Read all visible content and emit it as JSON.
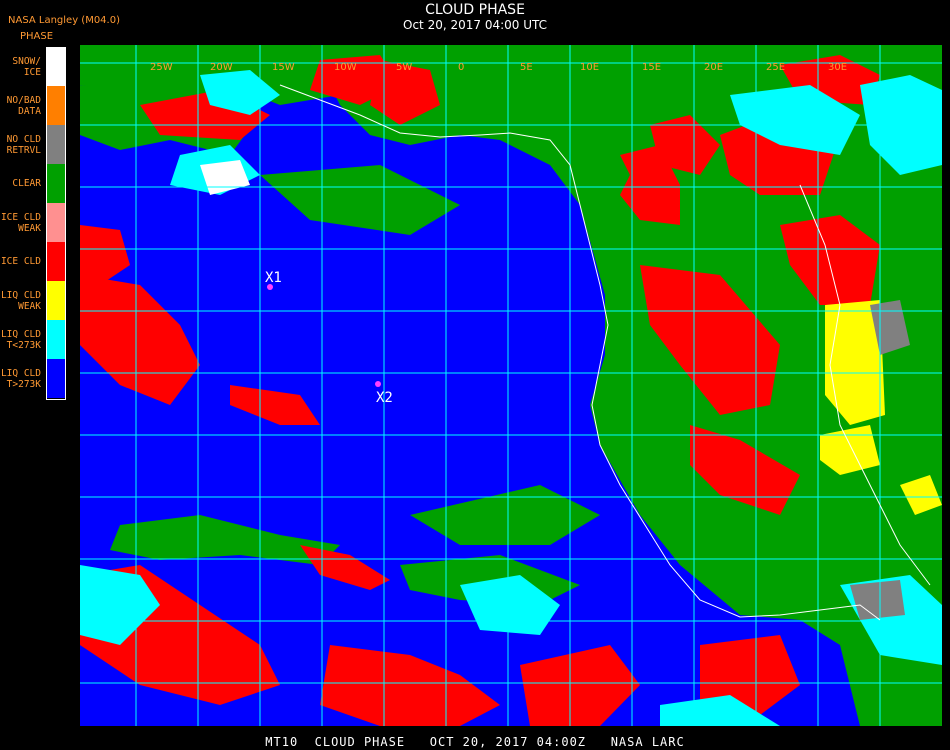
{
  "header": {
    "title": "CLOUD PHASE",
    "timestamp": "Oct 20, 2017 04:00 UTC",
    "org_label": "NASA Langley (M04.0)"
  },
  "legend": {
    "title": "PHASE",
    "items": [
      {
        "lines": [
          "SNOW/",
          "ICE"
        ],
        "color": "#ffffff"
      },
      {
        "lines": [
          "NO/BAD",
          "DATA"
        ],
        "color": "#ff7f00"
      },
      {
        "lines": [
          "NO CLD",
          "RETRVL"
        ],
        "color": "#808080"
      },
      {
        "lines": [
          "CLEAR"
        ],
        "color": "#00a000"
      },
      {
        "lines": [
          "ICE CLD",
          "WEAK"
        ],
        "color": "#ff9090"
      },
      {
        "lines": [
          "ICE CLD"
        ],
        "color": "#ff0000"
      },
      {
        "lines": [
          "LIQ CLD",
          "WEAK"
        ],
        "color": "#ffff00"
      },
      {
        "lines": [
          "LIQ CLD",
          "T<273K"
        ],
        "color": "#00ffff"
      },
      {
        "lines": [
          "LIQ CLD",
          "T>273K"
        ],
        "color": "#0000ff"
      }
    ]
  },
  "map": {
    "longitude_labels": [
      "25W",
      "20W",
      "15W",
      "10W",
      "5W",
      "0",
      "5E",
      "10E",
      "15E",
      "20E",
      "25E",
      "30E"
    ],
    "markers": [
      {
        "label": "X1",
        "color": "#ff40ff"
      },
      {
        "label": "X2",
        "color": "#ff40ff"
      }
    ],
    "colors": {
      "grid": "#00ffff",
      "coast": "#ffffff",
      "longitude_label": "#ff9933"
    }
  },
  "footer": {
    "text": "MT10  CLOUD PHASE   OCT 20, 2017 04:00Z   NASA LARC"
  }
}
